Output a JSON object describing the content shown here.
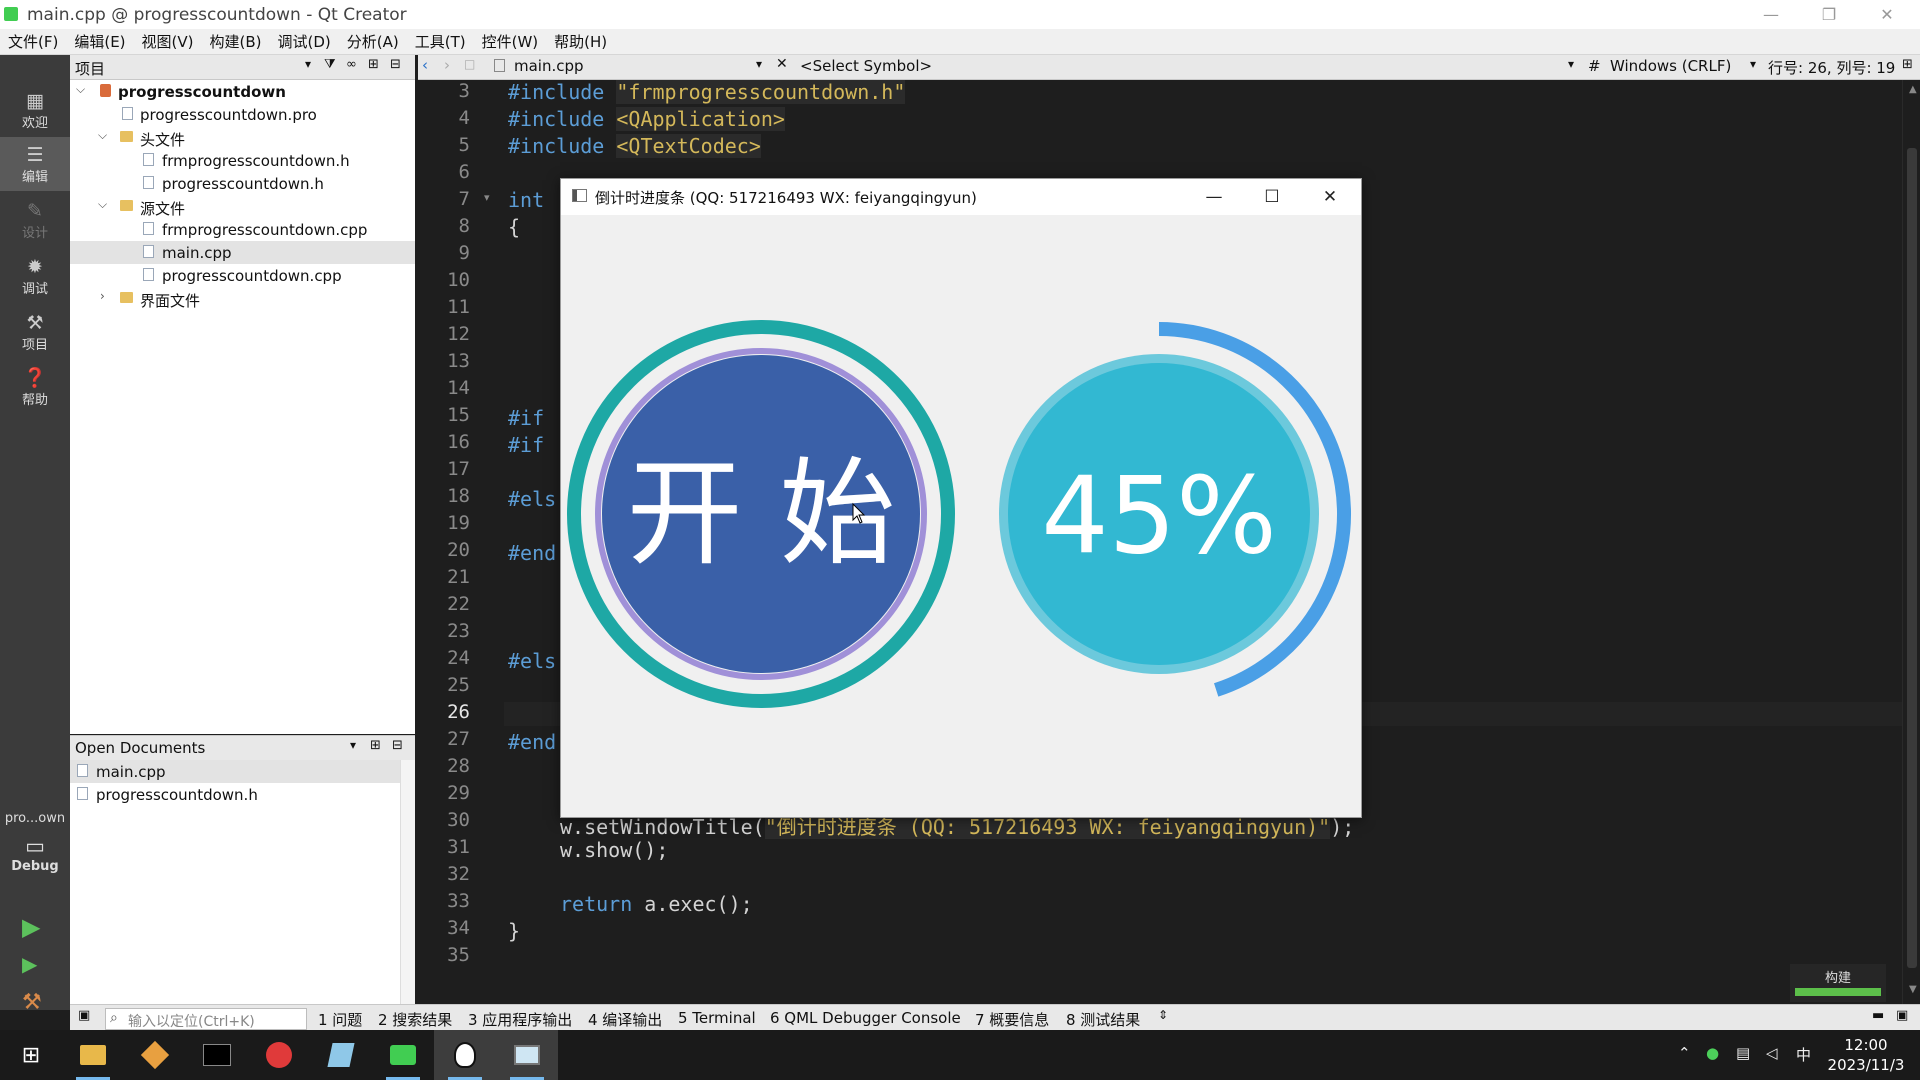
{
  "window": {
    "title": "main.cpp @ progresscountdown - Qt Creator"
  },
  "menu": [
    "文件(F)",
    "编辑(E)",
    "视图(V)",
    "构建(B)",
    "调试(D)",
    "分析(A)",
    "工具(T)",
    "控件(W)",
    "帮助(H)"
  ],
  "modes": [
    {
      "label": "欢迎",
      "icon": "grid-icon"
    },
    {
      "label": "编辑",
      "icon": "edit-icon"
    },
    {
      "label": "设计",
      "icon": "pencil-icon"
    },
    {
      "label": "调试",
      "icon": "bug-icon"
    },
    {
      "label": "项目",
      "icon": "wrench-icon"
    },
    {
      "label": "帮助",
      "icon": "help-icon"
    }
  ],
  "kit": {
    "name": "pro...own",
    "config": "Debug"
  },
  "project_pane": {
    "header": "项目",
    "tree": {
      "root": "progresscountdown",
      "pro_file": "progresscountdown.pro",
      "headers_folder": "头文件",
      "header_files": [
        "frmprogresscountdown.h",
        "progresscountdown.h"
      ],
      "sources_folder": "源文件",
      "source_files": [
        "frmprogresscountdown.cpp",
        "main.cpp",
        "progresscountdown.cpp"
      ],
      "forms_folder": "界面文件"
    }
  },
  "open_documents": {
    "header": "Open Documents",
    "files": [
      "main.cpp",
      "progresscountdown.h"
    ]
  },
  "editor": {
    "file": "main.cpp",
    "symbol": "<Select Symbol>",
    "hash": "#",
    "line_ending": "Windows (CRLF)",
    "position": "行号: 26, 列号: 19",
    "line_numbers": [
      "3",
      "4",
      "5",
      "6",
      "7",
      "8",
      "9",
      "10",
      "11",
      "12",
      "13",
      "14",
      "15",
      "16",
      "17",
      "18",
      "19",
      "20",
      "21",
      "22",
      "23",
      "24",
      "25",
      "26",
      "27",
      "28",
      "29",
      "30",
      "31",
      "32",
      "33",
      "34",
      "35"
    ],
    "current_line": "26",
    "code": {
      "l3_pp": "#include ",
      "l3_str": "\"frmprogresscountdown.h\"",
      "l4_pp": "#include ",
      "l4_str": "<QApplication>",
      "l5_pp": "#include ",
      "l5_str": "<QTextCodec>",
      "l7": "int",
      "l8": "{",
      "l15": "#if",
      "l16": "#if",
      "l18": "#els",
      "l20": "#end",
      "l24": "#els",
      "l27": "#end",
      "l30_a": "w.setWindowTitle(",
      "l30_str": "\"倒计时进度条 (QQ: 517216493 WX: feiyangqingyun)\"",
      "l30_b": ");",
      "l31": "w.show();",
      "l33_kw": "return",
      "l33_rest": " a.exec();",
      "l34": "}"
    }
  },
  "build_badge": {
    "label": "构建"
  },
  "output_bar": {
    "locate_placeholder": "输入以定位(Ctrl+K)",
    "tabs": [
      "1 问题",
      "2 搜索结果",
      "3 应用程序输出",
      "4 编译输出",
      "5 Terminal",
      "6 QML Debugger Console",
      "7 概要信息",
      "8 测试结果"
    ]
  },
  "app_window": {
    "title": "倒计时进度条 (QQ: 517216493 WX: feiyangqingyun)",
    "start_label": "开 始",
    "progress_label": "45%",
    "progress": 0.45,
    "colors": {
      "start_outer_ring": "#1ea8a5",
      "start_inner_ring": "#a090d8",
      "start_fill": "#3a60a8",
      "progress_arc": "#4a9fe6",
      "progress_ring": "#6cc9dc",
      "progress_fill": "#32b8d2"
    }
  },
  "taskbar": {
    "clock_time": "12:00",
    "clock_date": "2023/11/3",
    "ime": "中"
  }
}
